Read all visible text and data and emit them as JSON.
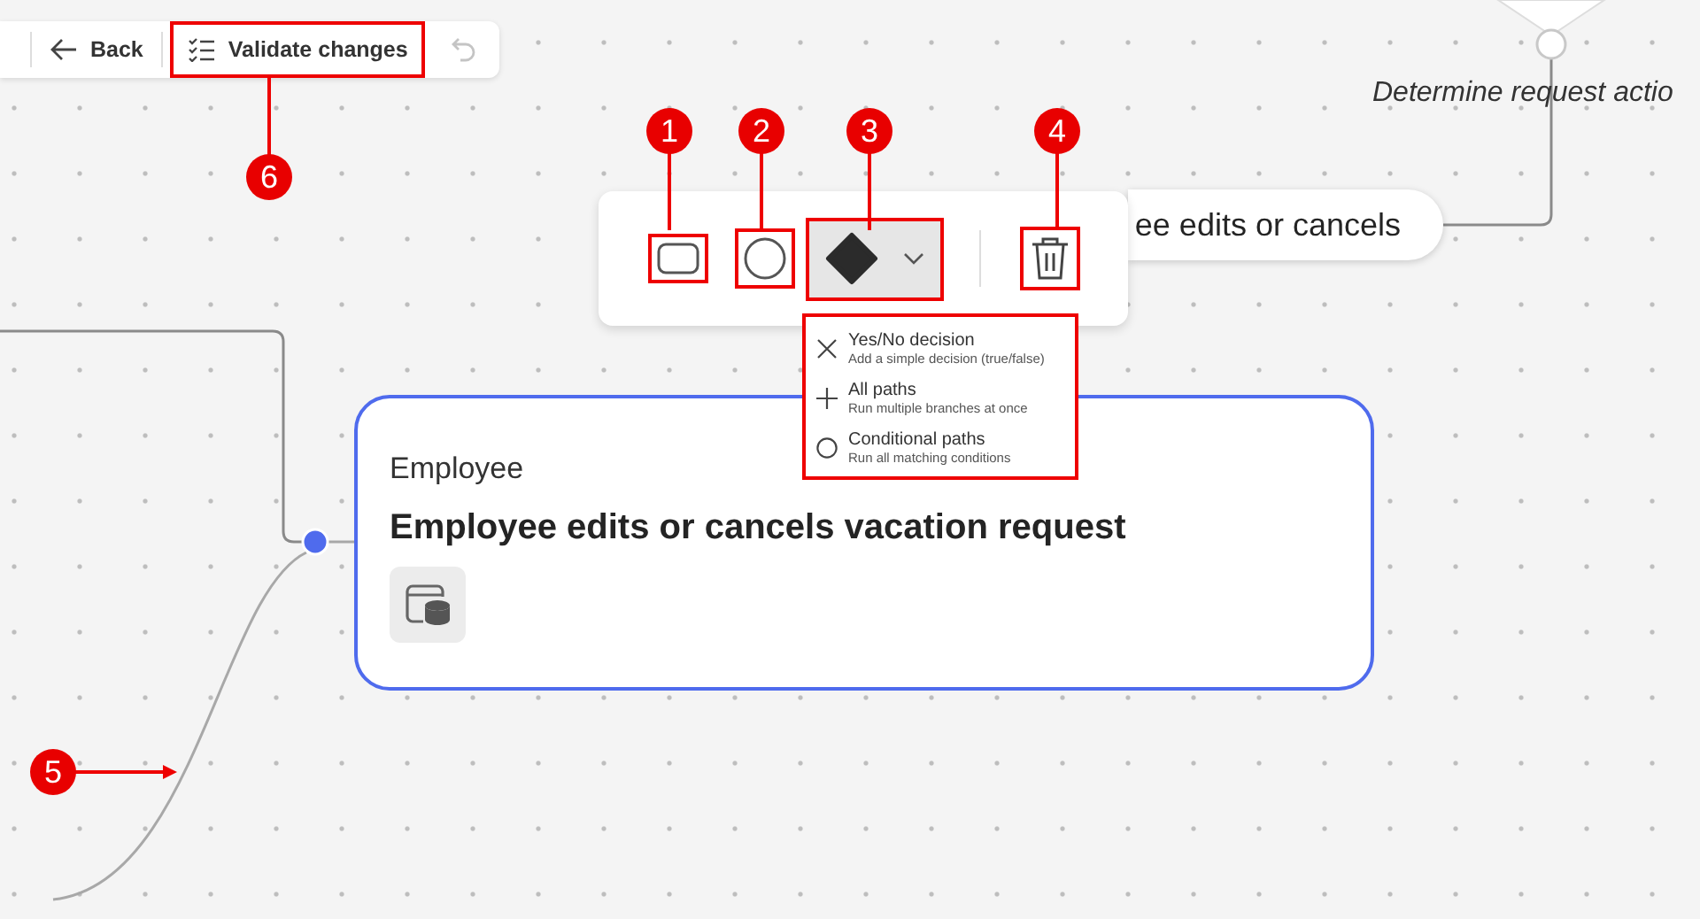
{
  "toolbar": {
    "back_label": "Back",
    "validate_label": "Validate changes",
    "undo_disabled": true
  },
  "flow": {
    "decision_label": "Determine request actio",
    "pill_label": "ee edits or cancels"
  },
  "shape_toolbar": {
    "tools": [
      {
        "kind": "rectangle"
      },
      {
        "kind": "circle"
      },
      {
        "kind": "diamond",
        "expanded": true
      }
    ]
  },
  "shape_menu": [
    {
      "kind": "cross",
      "title": "Yes/No decision",
      "description": "Add a simple decision (true/false)"
    },
    {
      "kind": "plus",
      "title": "All paths",
      "description": "Run multiple branches at once"
    },
    {
      "kind": "ring",
      "title": "Conditional paths",
      "description": "Run all matching conditions"
    }
  ],
  "node": {
    "subtitle": "Employee",
    "title": "Employee edits or cancels vacation request",
    "selected": true
  },
  "callouts": [
    {
      "label": "1"
    },
    {
      "label": "2"
    },
    {
      "label": "3"
    },
    {
      "label": "4"
    },
    {
      "label": "5"
    },
    {
      "label": "6"
    }
  ]
}
